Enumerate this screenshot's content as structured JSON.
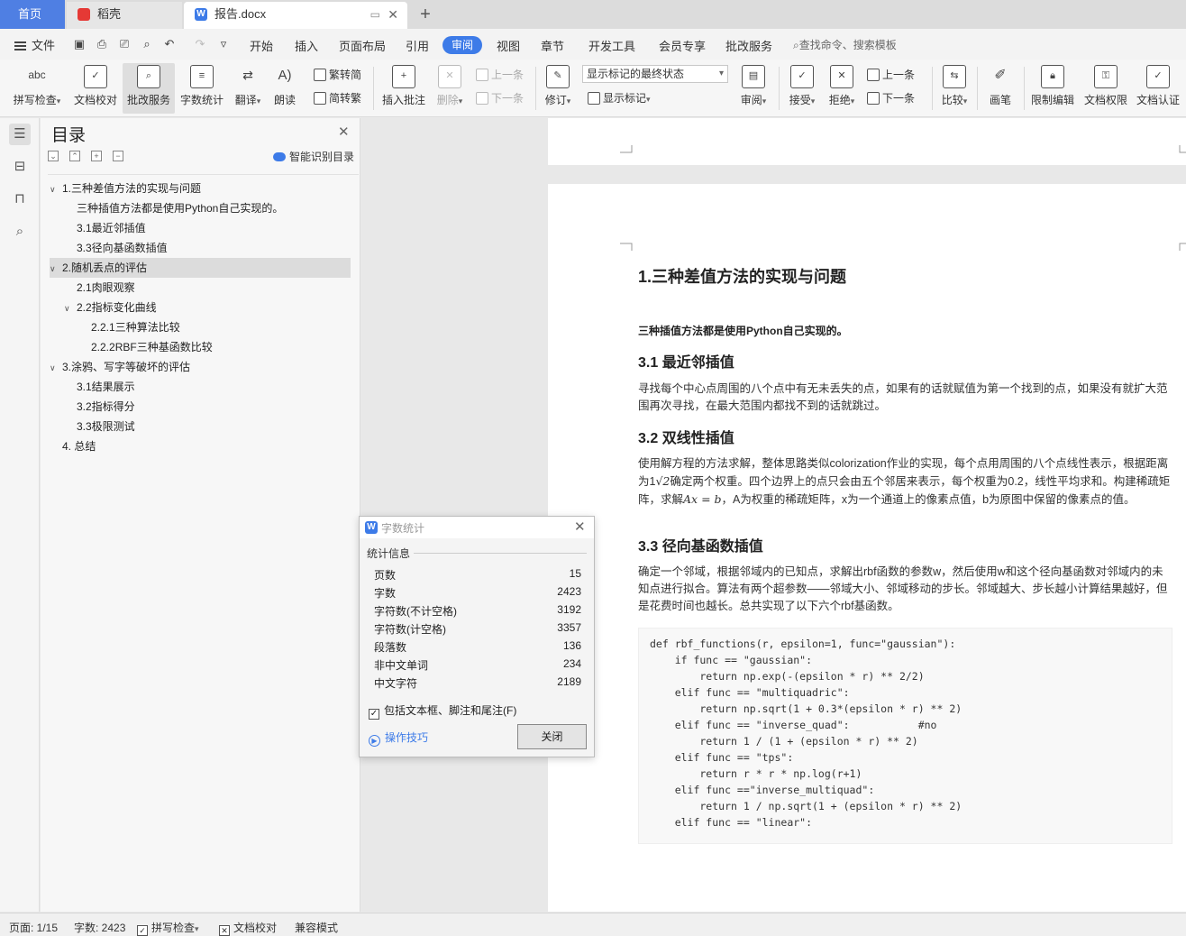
{
  "tabs": {
    "home": "首页",
    "daoke": "稻壳",
    "doc": "报告.docx"
  },
  "menu": {
    "file": "文件",
    "items": [
      "开始",
      "插入",
      "页面布局",
      "引用",
      "审阅",
      "视图",
      "章节",
      "开发工具",
      "会员专享",
      "批改服务"
    ],
    "active": "审阅",
    "search_placeholder": "查找命令、搜索模板"
  },
  "ribbon": {
    "spell_check": "拼写检查",
    "doc_proof": "文档校对",
    "correction_service": "批改服务",
    "word_count": "字数统计",
    "translate": "翻译",
    "read_aloud": "朗读",
    "trad_to_simp": "繁转简",
    "simp_to_trad": "简转繁",
    "insert_comment": "插入批注",
    "delete": "删除",
    "prev_comment": "上一条",
    "next_comment": "下一条",
    "revise": "修订",
    "markup_state": "显示标记的最终状态",
    "show_markup": "显示标记",
    "review": "审阅",
    "accept": "接受",
    "reject": "拒绝",
    "prev_change": "上一条",
    "next_change": "下一条",
    "compare": "比较",
    "pen": "画笔",
    "restrict_edit": "限制编辑",
    "doc_permission": "文档权限",
    "doc_certify": "文档认证"
  },
  "toc": {
    "title": "目录",
    "smart": "智能识别目录",
    "items": [
      {
        "label": "1.三种差值方法的实现与问题",
        "caret": "∨"
      },
      {
        "label": "三种插值方法都是使用Python自己实现的。",
        "caret": ""
      },
      {
        "label": "3.1最近邻插值",
        "caret": ""
      },
      {
        "label": "3.3径向基函数插值",
        "caret": ""
      },
      {
        "label": "2.随机丢点的评估",
        "caret": "∨"
      },
      {
        "label": "2.1肉眼观察",
        "caret": ""
      },
      {
        "label": "2.2指标变化曲线",
        "caret": "∨"
      },
      {
        "label": "2.2.1三种算法比较",
        "caret": ""
      },
      {
        "label": "2.2.2RBF三种基函数比较",
        "caret": ""
      },
      {
        "label": "3.涂鸦、写字等破坏的评估",
        "caret": "∨"
      },
      {
        "label": "3.1结果展示",
        "caret": ""
      },
      {
        "label": "3.2指标得分",
        "caret": ""
      },
      {
        "label": "3.3极限测试",
        "caret": ""
      },
      {
        "label": "4. 总结",
        "caret": ""
      }
    ]
  },
  "doc": {
    "h1": "1.三种差值方法的实现与问题",
    "bold_line": "三种插值方法都是使用Python自己实现的。",
    "h2_1": "3.1 最近邻插值",
    "p1": "寻找每个中心点周围的八个点中有无未丢失的点，如果有的话就赋值为第一个找到的点，如果没有就扩大范围再次寻找，在最大范围内都找不到的话就跳过。",
    "h2_2": "3.2 双线性插值",
    "p2_a": "使用解方程的方法求解，整体思路类似colorization作业的实现，每个点用周围的八个点线性表示，根据距离为1",
    "p2_sqrt": "√2",
    "p2_b": "确定两个权重。四个边界上的点只会由五个邻居来表示，每个权重为0.2，线性平均求和。构建稀疏矩阵，求解",
    "p2_math": "Ax = b",
    "p2_c": "，A为权重的稀疏矩阵，x为一个通道上的像素点值，b为原图中保留的像素点的值。",
    "h2_3": "3.3 径向基函数插值",
    "p3": "确定一个邻域，根据邻域内的已知点，求解出rbf函数的参数w，然后使用w和这个径向基函数对邻域内的未知点进行拟合。算法有两个超参数——邻域大小、邻域移动的步长。邻域越大、步长越小计算结果越好，但是花费时间也越长。总共实现了以下六个rbf基函数。",
    "code_lines": [
      "def rbf_functions(r, epsilon=1, func=\"gaussian\"):",
      "    if func == \"gaussian\":",
      "        return np.exp(-(epsilon * r) ** 2/2)",
      "    elif func == \"multiquadric\":",
      "        return np.sqrt(1 + 0.3*(epsilon * r) ** 2)",
      "    elif func == \"inverse_quad\":           #no",
      "        return 1 / (1 + (epsilon * r) ** 2)",
      "    elif func == \"tps\":",
      "        return r * r * np.log(r+1)",
      "    elif func ==\"inverse_multiquad\":",
      "        return 1 / np.sqrt(1 + (epsilon * r) ** 2)",
      "    elif func == \"linear\":"
    ]
  },
  "dialog": {
    "title": "字数统计",
    "section": "统计信息",
    "rows": [
      {
        "label": "页数",
        "value": "15"
      },
      {
        "label": "字数",
        "value": "2423"
      },
      {
        "label": "字符数(不计空格)",
        "value": "3192"
      },
      {
        "label": "字符数(计空格)",
        "value": "3357"
      },
      {
        "label": "段落数",
        "value": "136"
      },
      {
        "label": "非中文单词",
        "value": "234"
      },
      {
        "label": "中文字符",
        "value": "2189"
      }
    ],
    "include_label": "包括文本框、脚注和尾注(F)",
    "include_checked": true,
    "tips": "操作技巧",
    "close": "关闭"
  },
  "status": {
    "page": "页面: 1/15",
    "words": "字数: 2423",
    "spell": "拼写检查",
    "proof": "文档校对",
    "compat": "兼容模式"
  },
  "colors": {
    "accent": "#3d7be8",
    "home_tab": "#4f7fe3"
  }
}
